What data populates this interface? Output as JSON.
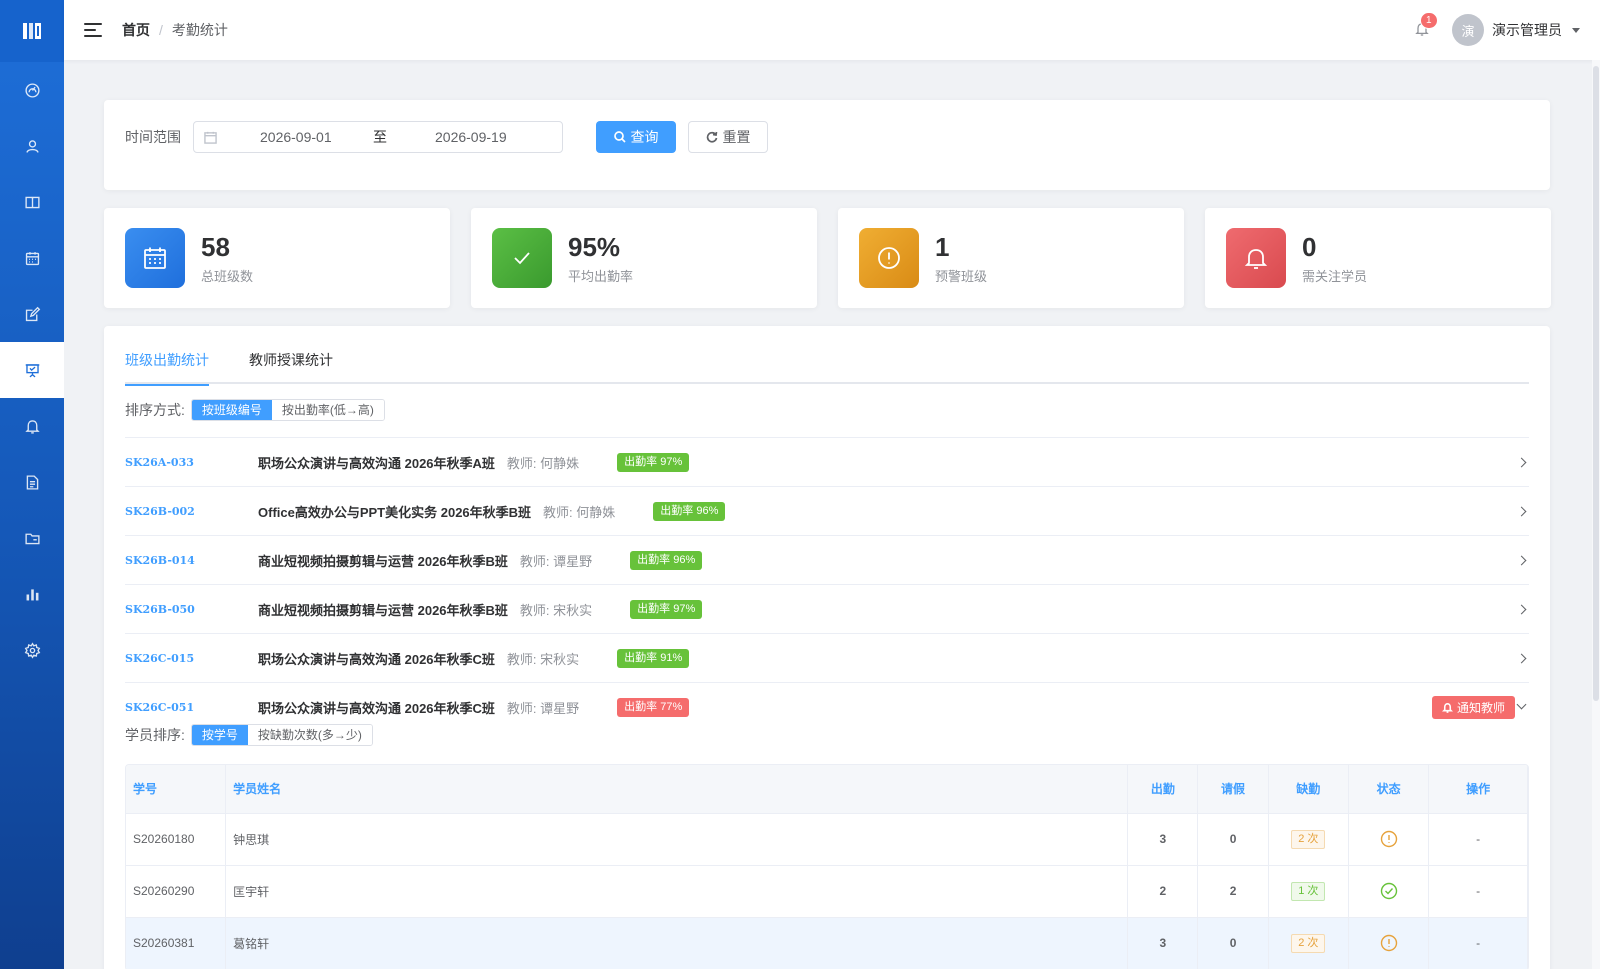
{
  "breadcrumb": {
    "home": "首页",
    "separator": "/",
    "current": "考勤统计"
  },
  "header": {
    "notification_count": "1",
    "avatar_text": "演",
    "username": "演示管理员"
  },
  "sidebar": {
    "items": [
      {
        "icon": "dashboard-icon"
      },
      {
        "icon": "user-icon"
      },
      {
        "icon": "book-icon"
      },
      {
        "icon": "calendar-icon"
      },
      {
        "icon": "edit-icon"
      },
      {
        "icon": "presentation-icon",
        "active": true
      },
      {
        "icon": "bell-icon"
      },
      {
        "icon": "document-icon"
      },
      {
        "icon": "folder-icon"
      },
      {
        "icon": "bar-chart-icon"
      },
      {
        "icon": "settings-icon"
      }
    ]
  },
  "filter": {
    "label": "时间范围",
    "start_date": "2026-09-01",
    "to": "至",
    "end_date": "2026-09-19",
    "search_label": "查询",
    "reset_label": "重置"
  },
  "stats": [
    {
      "value": "58",
      "label": "总班级数",
      "color": "#2f80ed",
      "icon": "calendar-icon"
    },
    {
      "value": "95%",
      "label": "平均出勤率",
      "color": "#4caf3a",
      "icon": "check-icon"
    },
    {
      "value": "1",
      "label": "预警班级",
      "color": "#e6a023",
      "icon": "warning-icon"
    },
    {
      "value": "0",
      "label": "需关注学员",
      "color": "#e85a5e",
      "icon": "bell-icon"
    }
  ],
  "tabs": [
    {
      "label": "班级出勤统计",
      "active": true
    },
    {
      "label": "教师授课统计",
      "active": false
    }
  ],
  "class_sort": {
    "label": "排序方式:",
    "options": [
      "按班级编号",
      "按出勤率(低→高)"
    ],
    "selected": 0
  },
  "classes": [
    {
      "code": "SK26A-033",
      "name": "职场公众演讲与高效沟通 2026年秋季A班",
      "teacher": "教师: 何静姝",
      "rate": "出勤率 97%",
      "status": "good"
    },
    {
      "code": "SK26B-002",
      "name": "Office高效办公与PPT美化实务 2026年秋季B班",
      "teacher": "教师: 何静姝",
      "rate": "出勤率 96%",
      "status": "good"
    },
    {
      "code": "SK26B-014",
      "name": "商业短视频拍摄剪辑与运营 2026年秋季B班",
      "teacher": "教师: 谭星野",
      "rate": "出勤率 96%",
      "status": "good"
    },
    {
      "code": "SK26B-050",
      "name": "商业短视频拍摄剪辑与运营 2026年秋季B班",
      "teacher": "教师: 宋秋实",
      "rate": "出勤率 97%",
      "status": "good"
    },
    {
      "code": "SK26C-015",
      "name": "职场公众演讲与高效沟通 2026年秋季C班",
      "teacher": "教师: 宋秋实",
      "rate": "出勤率 91%",
      "status": "good"
    },
    {
      "code": "SK26C-051",
      "name": "职场公众演讲与高效沟通 2026年秋季C班",
      "teacher": "教师: 谭星野",
      "rate": "出勤率 77%",
      "status": "bad",
      "expanded": true,
      "notify_label": "通知教师"
    }
  ],
  "student_sort": {
    "label": "学员排序:",
    "options": [
      "按学号",
      "按缺勤次数(多→少)"
    ],
    "selected": 0
  },
  "student_table": {
    "headers": [
      "学号",
      "学员姓名",
      "出勤",
      "请假",
      "缺勤",
      "状态",
      "操作"
    ],
    "rows": [
      {
        "id": "S20260180",
        "name": "钟思琪",
        "present": "3",
        "leave": "0",
        "absent": "2 次",
        "status": "warning",
        "op": "-"
      },
      {
        "id": "S20260290",
        "name": "匡宇轩",
        "present": "2",
        "leave": "2",
        "absent": "1 次",
        "status": "ok",
        "op": "-"
      },
      {
        "id": "S20260381",
        "name": "葛铭轩",
        "present": "3",
        "leave": "0",
        "absent": "2 次",
        "status": "warning",
        "op": "-"
      }
    ]
  }
}
